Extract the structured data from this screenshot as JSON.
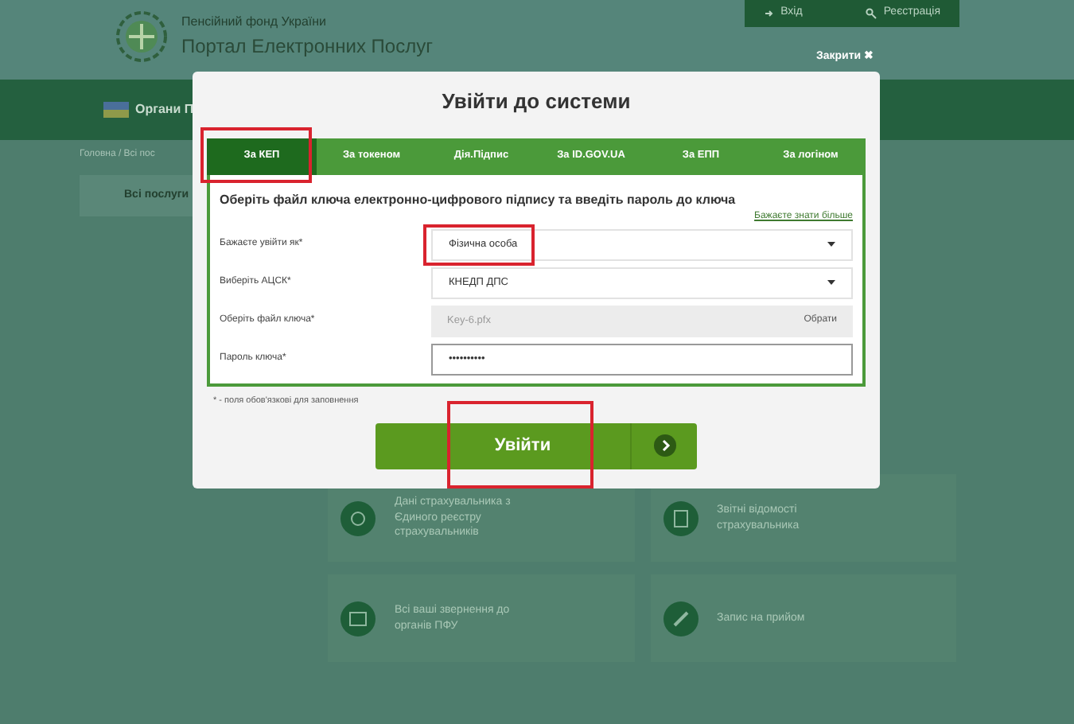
{
  "header": {
    "org": "Пенсійний фонд України",
    "portal": "Портал Електронних Послуг",
    "buttons": [
      {
        "label": "Вхід",
        "kind": "login"
      },
      {
        "label": "Реєстрація",
        "kind": "register"
      }
    ],
    "close": "Закрити ✖"
  },
  "nav": {
    "items": [
      "Органи П"
    ]
  },
  "breadcrumb": "Головна / Всі пос",
  "sidebar": {
    "items": [
      {
        "label": "Всі послуги",
        "selected": true
      }
    ]
  },
  "services": [
    {
      "title": "Дані страхувальника з Єдиного реєстру страхувальників",
      "kind": "chat"
    },
    {
      "title": "Звітні відомості страхувальника",
      "kind": "doc"
    },
    {
      "title": "Всі ваші звернення до органів ПФУ",
      "kind": "mail"
    },
    {
      "title": "Запис на прийом",
      "kind": "edit"
    }
  ],
  "modal": {
    "title": "Увійти до системи",
    "tabs": [
      {
        "label": "За КЕП",
        "selected": true,
        "highlighted": true
      },
      {
        "label": "За токеном",
        "selected": false,
        "highlighted": false
      },
      {
        "label": "Дія.Підпис",
        "selected": false,
        "highlighted": false
      },
      {
        "label": "За ID.GOV.UA",
        "selected": false,
        "highlighted": false
      },
      {
        "label": "За ЕПП",
        "selected": false,
        "highlighted": false
      },
      {
        "label": "За логіном",
        "selected": false,
        "highlighted": false
      }
    ],
    "instruction": "Оберіть файл ключа електронно-цифрового підпису та введіть пароль до ключа",
    "help_link": "Бажаєте знати більше",
    "fields": [
      {
        "label": "Бажаєте увійти як*",
        "kind": "select",
        "value": "Фізична особа",
        "highlighted": true
      },
      {
        "label": "Виберіть АЦСК*",
        "kind": "select",
        "value": "КНЕДП ДПС",
        "highlighted": false
      },
      {
        "label": "Оберіть файл ключа*",
        "kind": "file",
        "value": "Key-6.pfx",
        "button": "Обрати",
        "highlighted": false
      },
      {
        "label": "Пароль ключа*",
        "kind": "password",
        "value": "••••••••••",
        "highlighted": false
      }
    ],
    "required_note": "* - поля обов'язкові для заповнення",
    "submit": {
      "label": "Увійти",
      "highlighted": true
    }
  }
}
